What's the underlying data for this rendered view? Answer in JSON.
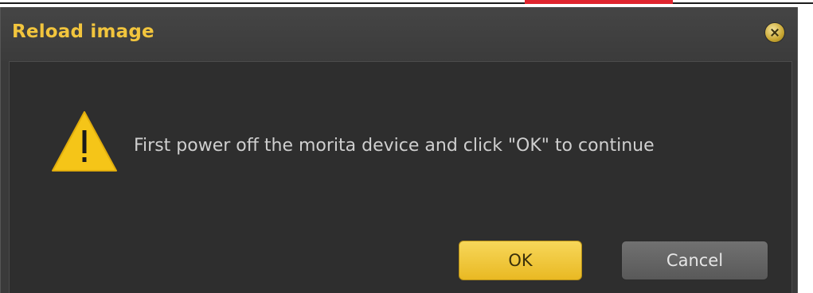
{
  "dialog": {
    "title": "Reload image",
    "message": "First power off the morita device and click \"OK\" to continue",
    "ok_label": "OK",
    "cancel_label": "Cancel",
    "icons": {
      "close": "close-icon",
      "warning": "warning-icon"
    }
  },
  "colors": {
    "title_text": "#f2c53d",
    "dialog_bg": "#3a3a3a",
    "content_bg": "#2e2e2e",
    "ok_button": "#f0c83a",
    "cancel_button": "#656565",
    "warning_icon": "#f5c518",
    "accent_red": "#e0242e"
  }
}
